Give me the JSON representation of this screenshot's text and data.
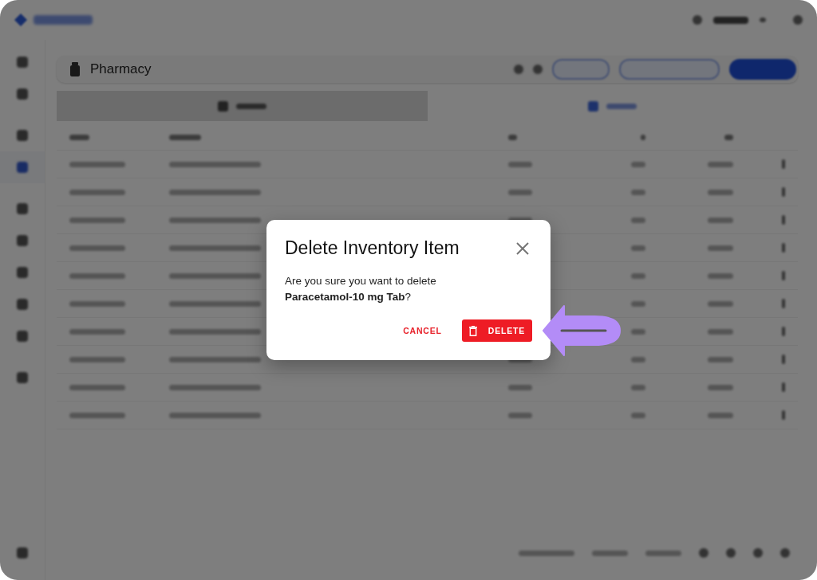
{
  "sidebar": {
    "items": [
      {
        "selected": false
      },
      {
        "selected": false
      },
      {
        "selected": false
      },
      {
        "selected": true
      },
      {
        "selected": false
      },
      {
        "selected": false
      },
      {
        "selected": false
      },
      {
        "selected": false
      },
      {
        "selected": false
      },
      {
        "selected": false
      }
    ]
  },
  "page": {
    "title": "Pharmacy"
  },
  "tabs": [
    {
      "selected": false
    },
    {
      "selected": true
    }
  ],
  "dialog": {
    "title": "Delete Inventory Item",
    "message": "Are you sure you want to delete **Paracetamol-10 mg Tab**?",
    "buttons": [
      {
        "label": "CANCEL",
        "kind": "text"
      },
      {
        "label": "DELETE",
        "kind": "danger"
      }
    ]
  }
}
